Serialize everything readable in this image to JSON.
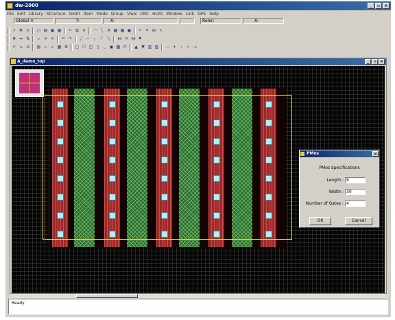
{
  "app": {
    "title": "dw-2000"
  },
  "menu": [
    "File",
    "Edit",
    "Library",
    "Structure",
    "GEdit",
    "Item",
    "Mode",
    "Group",
    "View",
    "DRC",
    "HLVS",
    "Window",
    "Link",
    "GPE",
    "Help"
  ],
  "fields": {
    "cell": "Global",
    "y_label": "Y:",
    "a_label": "A:",
    "ruler_label": "Ruler:",
    "a2_label": "A:"
  },
  "child_window": {
    "title": "A_demo_top"
  },
  "dialog": {
    "title": "PMos",
    "heading": "PMos Specifications",
    "length_label": "Length :",
    "length_value": "8",
    "width_label": "Width :",
    "width_value": "30",
    "gates_label": "Number of Gates :",
    "gates_value": "4",
    "ok_label": "OK",
    "cancel_label": "Cancel"
  },
  "output": {
    "message": "Ready"
  },
  "colors": {
    "metal": "#9a2b2b",
    "poly": "#2c6a2c",
    "contact": "#bfe8ef",
    "boundary": "#e8e050",
    "titlebar": "#0a246a"
  }
}
